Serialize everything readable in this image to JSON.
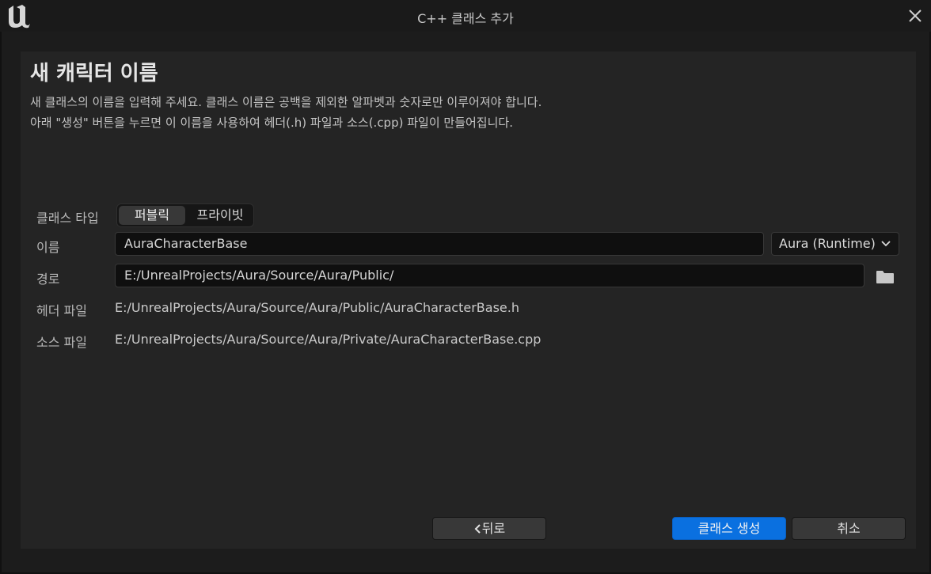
{
  "window": {
    "title": "C++ 클래스 추가"
  },
  "page": {
    "heading": "새 캐릭터 이름",
    "description_line1": "새 클래스의 이름을 입력해 주세요. 클래스 이름은 공백을 제외한 알파벳과 숫자로만 이루어져야 합니다.",
    "description_line2": "아래 \"생성\" 버튼을 누르면 이 이름을 사용하여 헤더(.h) 파일과 소스(.cpp) 파일이 만들어집니다."
  },
  "form": {
    "class_type_label": "클래스 타입",
    "class_type_options": [
      "퍼블릭",
      "프라이빗"
    ],
    "class_type_selected": "퍼블릭",
    "name_label": "이름",
    "name_value": "AuraCharacterBase",
    "module_selected": "Aura (Runtime)",
    "path_label": "경로",
    "path_value": "E:/UnrealProjects/Aura/Source/Aura/Public/",
    "header_file_label": "헤더 파일",
    "header_file_value": "E:/UnrealProjects/Aura/Source/Aura/Public/AuraCharacterBase.h",
    "source_file_label": "소스 파일",
    "source_file_value": "E:/UnrealProjects/Aura/Source/Aura/Private/AuraCharacterBase.cpp"
  },
  "buttons": {
    "back_label": "뒤로",
    "create_label": "클래스 생성",
    "cancel_label": "취소"
  },
  "icons": {
    "logo": "unreal-engine-logo",
    "close": "close-icon",
    "dropdown": "chevron-down-icon",
    "browse": "folder-icon",
    "back": "chevron-left-icon"
  },
  "colors": {
    "accent": "#0a70e0",
    "background": "#242424",
    "titlebar": "#1a1a1a"
  }
}
